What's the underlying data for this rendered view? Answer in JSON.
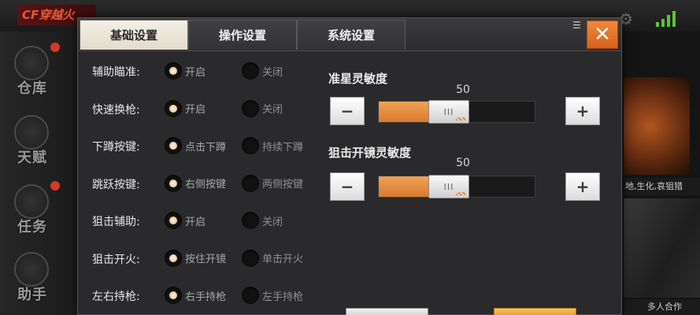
{
  "background": {
    "logo_text": "CF穿越火",
    "nav_items": [
      {
        "label": "仓库",
        "has_dot": true
      },
      {
        "label": "天赋",
        "has_dot": false
      },
      {
        "label": "任务",
        "has_dot": true
      },
      {
        "label": "助手",
        "has_dot": false
      }
    ],
    "poster_captions": [
      "地,生化,哀狙猎",
      "多人合作"
    ]
  },
  "dialog": {
    "tabs": [
      {
        "label": "基础设置",
        "active": true
      },
      {
        "label": "操作设置",
        "active": false
      },
      {
        "label": "系统设置",
        "active": false
      }
    ],
    "close_icon": "close-icon",
    "settings": [
      {
        "label": "辅助瞄准:",
        "options": [
          "开启",
          "关闭"
        ],
        "selected": 0
      },
      {
        "label": "快速换枪:",
        "options": [
          "开启",
          "关闭"
        ],
        "selected": 0
      },
      {
        "label": "下蹲按键:",
        "options": [
          "点击下蹲",
          "持续下蹲"
        ],
        "selected": 0
      },
      {
        "label": "跳跃按键:",
        "options": [
          "右侧按键",
          "两侧按键"
        ],
        "selected": 0
      },
      {
        "label": "狙击辅助:",
        "options": [
          "开启",
          "关闭"
        ],
        "selected": 0
      },
      {
        "label": "狙击开火:",
        "options": [
          "按住开镜",
          "单击开火"
        ],
        "selected": 0
      },
      {
        "label": "左右持枪:",
        "options": [
          "右手持枪",
          "左手持枪"
        ],
        "selected": 0
      }
    ],
    "sensitivity": [
      {
        "title": "准星灵敏度",
        "value": "50",
        "level": 0.5,
        "minus": "−",
        "plus": "+"
      },
      {
        "title": "狙击开镜灵敏度",
        "value": "50",
        "level": 0.5,
        "minus": "−",
        "plus": "+"
      }
    ],
    "colors": {
      "accent": "#e8893a",
      "close": "#e5702a"
    }
  }
}
